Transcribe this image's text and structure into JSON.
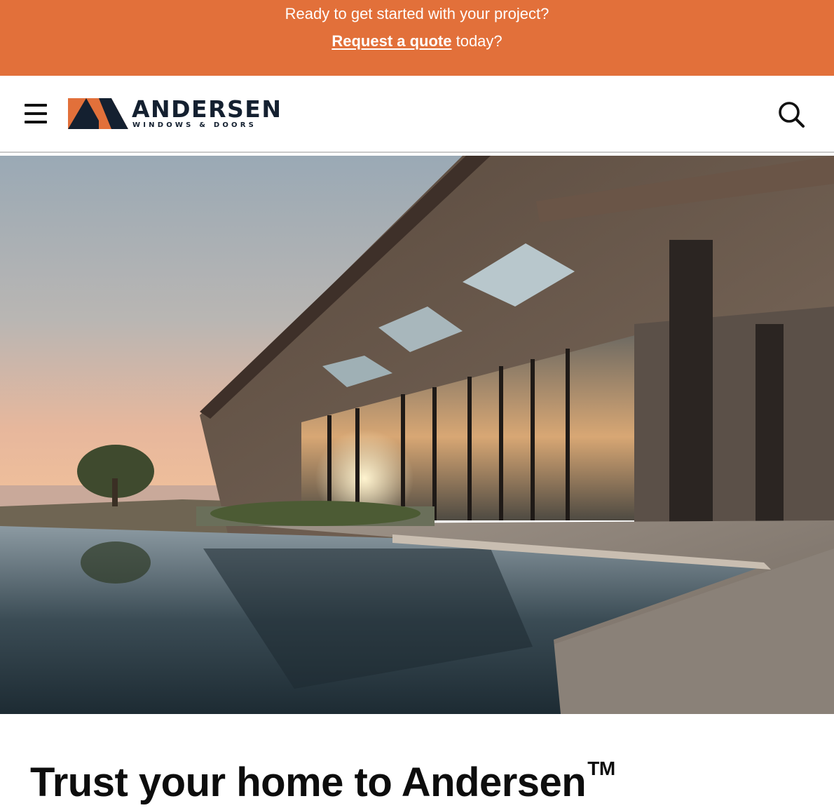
{
  "promo": {
    "line1": "Ready to get started with your project?",
    "link_text": "Request a quote",
    "line2_suffix": " today?"
  },
  "header": {
    "menu_icon": "hamburger-menu-icon",
    "logo": {
      "name": "ANDERSEN",
      "tagline": "WINDOWS & DOORS",
      "colors": {
        "orange": "#e2703a",
        "navy": "#142030"
      }
    },
    "search_icon": "search-icon"
  },
  "hero": {
    "image": "modern-house-with-pool-at-sunset"
  },
  "headline": {
    "text": "Trust your home to Andersen",
    "trademark": "TM"
  },
  "colors": {
    "banner": "#e2703a",
    "text_dark": "#0d0d0d",
    "divider": "#c9c9c9"
  }
}
